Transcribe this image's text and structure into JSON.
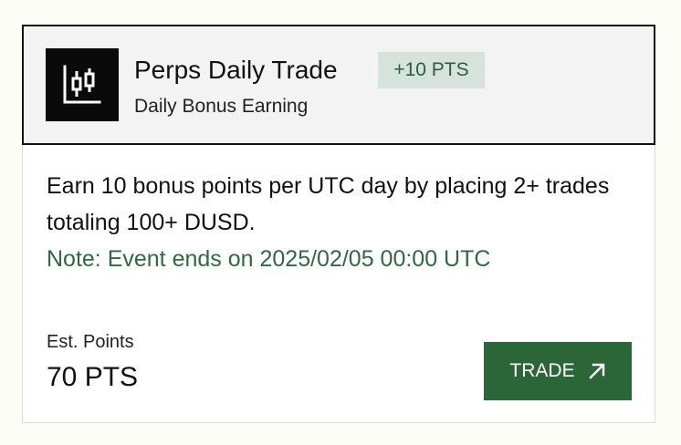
{
  "card": {
    "title": "Perps Daily Trade",
    "badge": "+10 PTS",
    "subtitle": "Daily Bonus Earning",
    "description": "Earn 10 bonus points per UTC day by placing 2+ trades totaling 100+ DUSD.",
    "note": "Note: Event ends on 2025/02/05 00:00 UTC",
    "est_label": "Est. Points",
    "est_value": "70 PTS",
    "button_label": "TRADE",
    "icons": {
      "logo": "candlestick-chart-icon",
      "button": "arrow-up-right-icon"
    },
    "colors": {
      "accent": "#2b6638",
      "note": "#2d6a40",
      "badge_bg": "#d6e2dc",
      "badge_text": "#2c5e3b",
      "header_bg": "#f3f3f3"
    }
  }
}
